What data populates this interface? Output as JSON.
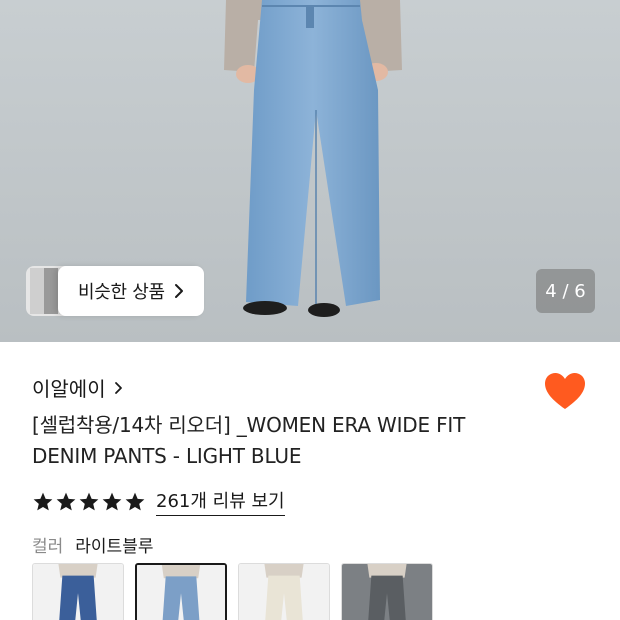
{
  "hero": {
    "similar_label": "비슷한 상품",
    "counter": "4 / 6",
    "current_index": 4,
    "total": 6
  },
  "product": {
    "brand": "이알에이",
    "title_line1": "[셀럽착용/14차 리오더] _WOMEN ERA WIDE FIT",
    "title_line2": "DENIM PANTS - LIGHT BLUE",
    "rating": 5,
    "reviews_label": "261개 리뷰 보기",
    "wishlisted": true
  },
  "color": {
    "label": "컬러",
    "value": "라이트블루",
    "options": [
      {
        "name": "dark-blue",
        "color": "#3b5f9a",
        "selected": false
      },
      {
        "name": "light-blue",
        "color": "#7c9fc7",
        "selected": true
      },
      {
        "name": "ivory",
        "color": "#e9e4d6",
        "selected": false
      },
      {
        "name": "gray",
        "color": "#5a5e62",
        "selected": false
      }
    ]
  },
  "colors": {
    "accent": "#ff5a1f",
    "star": "#1a1a1a",
    "text": "#1a1a1a",
    "muted": "#8a8a8a"
  },
  "icons": {
    "wishlist": "heart-icon",
    "brand_arrow": "chevron-right-icon",
    "rating": "star-icon"
  }
}
